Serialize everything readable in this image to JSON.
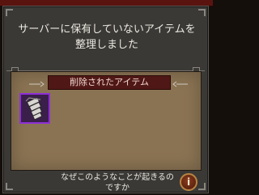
{
  "dialog": {
    "title": "サーバーに保有していないアイテムを整理しました",
    "section_header": "削除されたアイテム",
    "removed_items": [
      {
        "icon": "armor-piece-icon",
        "rarity_color": "#8f2fd9"
      }
    ],
    "footer_question": "なぜこのようなことが起きるのですか",
    "info_button_icon": "info-icon"
  },
  "colors": {
    "frame": "#3a3936",
    "panel": "#8a7353",
    "header_band": "#4f1816",
    "item_border": "#8f2fd9",
    "info_button": "#8c3b1c"
  }
}
